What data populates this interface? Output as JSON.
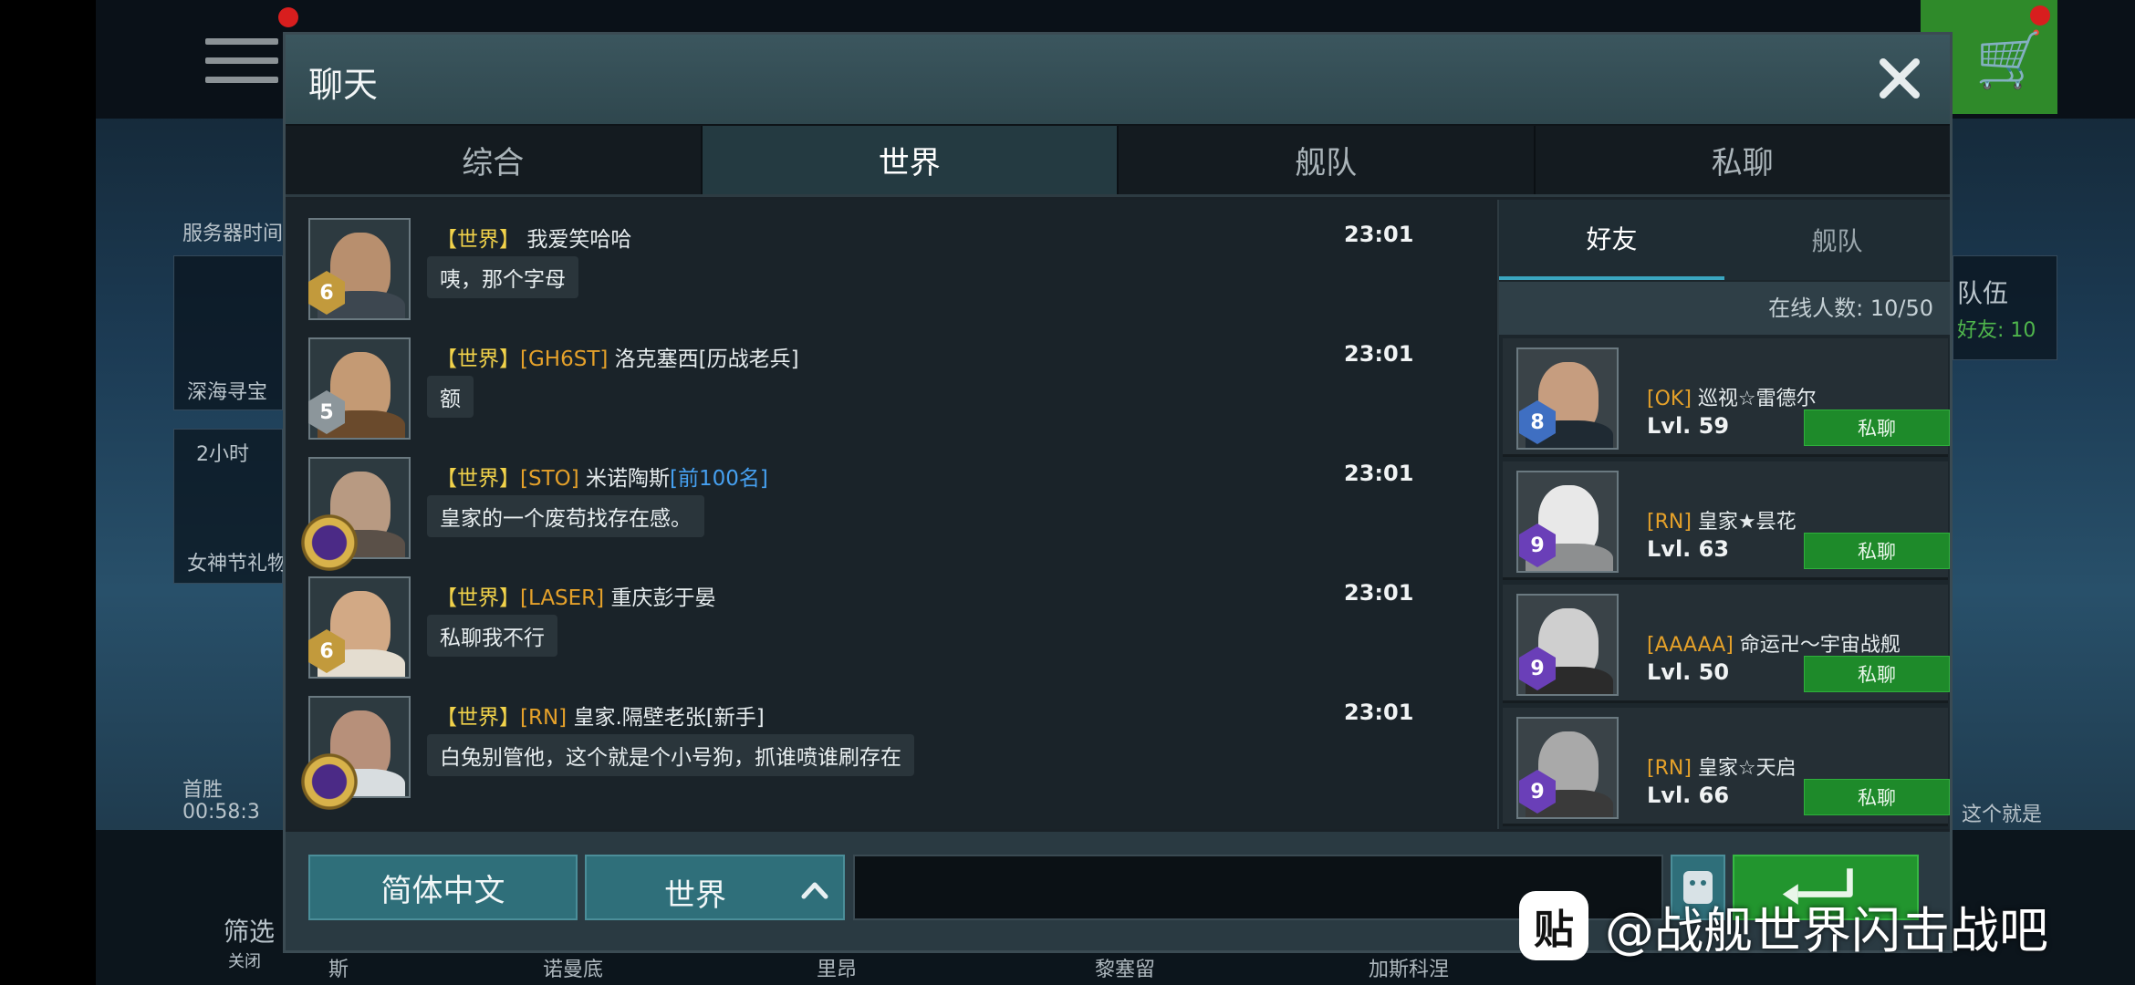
{
  "dialog": {
    "title": "聊天",
    "tabs": [
      {
        "label": "综合",
        "active": false
      },
      {
        "label": "世界",
        "active": true
      },
      {
        "label": "舰队",
        "active": false
      },
      {
        "label": "私聊",
        "active": false
      }
    ]
  },
  "messages": [
    {
      "channel": "【世界】",
      "tag": "",
      "name": "我爱笑哈哈",
      "title": "",
      "time": "23:01",
      "text": "咦，那个字母",
      "rank": "6"
    },
    {
      "channel": "【世界】",
      "tag": "[GH6ST]",
      "name": "洛克塞西[历战老兵]",
      "title": "",
      "time": "23:01",
      "text": "额",
      "rank": "5"
    },
    {
      "channel": "【世界】",
      "tag": "[STO]",
      "name": "米诺陶斯",
      "title": "[前100名]",
      "time": "23:01",
      "text": "皇家的一个废苟找存在感。",
      "rank": ""
    },
    {
      "channel": "【世界】",
      "tag": "[LASER]",
      "name": "重庆彭于晏",
      "title": "",
      "time": "23:01",
      "text": "私聊我不行",
      "rank": "6"
    },
    {
      "channel": "【世界】",
      "tag": "[RN]",
      "name": "皇家.隔壁老张[新手]",
      "title": "",
      "time": "23:01",
      "text": "白兔别管他，这个就是个小号狗，抓谁喷谁刷存在",
      "rank": ""
    }
  ],
  "friends_panel": {
    "tabs": [
      {
        "label": "好友",
        "active": true
      },
      {
        "label": "舰队",
        "active": false
      }
    ],
    "online_count": "在线人数: 10/50",
    "friends": [
      {
        "tag": "[OK]",
        "name": "巡视☆雷德尔",
        "level": "Lvl. 59",
        "rank": "8",
        "button": "私聊"
      },
      {
        "tag": "[RN]",
        "name": "皇家★昙花",
        "level": "Lvl. 63",
        "rank": "9",
        "button": "私聊"
      },
      {
        "tag": "[AAAAA]",
        "name": "命运卍～宇宙战舰",
        "level": "Lvl. 50",
        "rank": "9",
        "button": "私聊"
      },
      {
        "tag": "[RN]",
        "name": "皇家☆天启",
        "level": "Lvl. 66",
        "rank": "9",
        "button": "私聊"
      }
    ]
  },
  "input_bar": {
    "language": "简体中文",
    "channel": "世界",
    "message_value": ""
  },
  "background": {
    "left_labels": [
      "服务器时间",
      "深海寻宝",
      "2小时",
      "女神节礼物",
      "首胜",
      "00:58:3"
    ],
    "right_labels": [
      "队伍",
      "好友: 10",
      "这个就是"
    ],
    "bottom_labels": [
      "筛选",
      "关闭",
      "斯",
      "诺曼底",
      "里昂",
      "黎塞留",
      "加斯科涅"
    ]
  },
  "watermark": {
    "logo": "贴",
    "text": "@战舰世界闪击战吧"
  },
  "colors": {
    "accent_teal": "#2f6f7a",
    "button_green": "#1e8a2a",
    "channel_yellow": "#f1d24a",
    "guild_tag_orange": "#e5a12a",
    "title_blue": "#46a0f0"
  }
}
